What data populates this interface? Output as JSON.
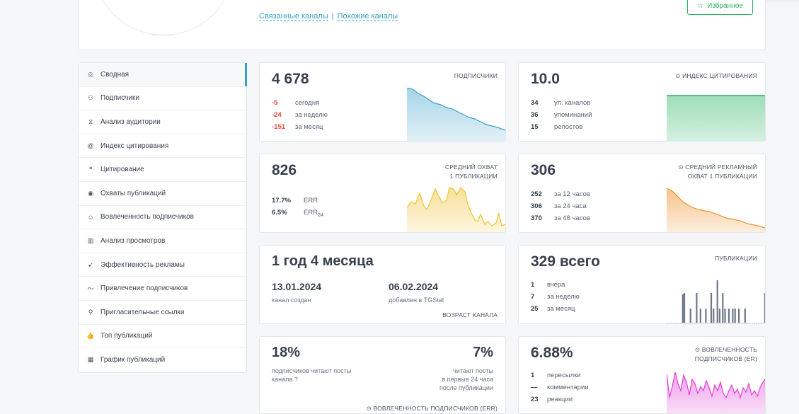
{
  "header": {
    "links": [
      "Связанные каналы",
      "Похожие каналы"
    ],
    "link_separator": "|",
    "favorite_label": "Избранное"
  },
  "sidebar": {
    "items": [
      {
        "label": "Сводная",
        "icon": "dashboard-icon",
        "active": true
      },
      {
        "label": "Подписчики",
        "icon": "users-icon"
      },
      {
        "label": "Анализ аудитории",
        "icon": "hourglass-icon"
      },
      {
        "label": "Индекс цитирования",
        "icon": "at-icon"
      },
      {
        "label": "Цитирование",
        "icon": "quote-icon"
      },
      {
        "label": "Охваты публикаций",
        "icon": "eye-icon"
      },
      {
        "label": "Вовлеченность подписчиков",
        "icon": "engagement-icon"
      },
      {
        "label": "Анализ просмотров",
        "icon": "bar-chart-icon"
      },
      {
        "label": "Эффективность рекламы",
        "icon": "rocket-icon"
      },
      {
        "label": "Привлечение подписчиков",
        "icon": "trend-icon"
      },
      {
        "label": "Пригласительные ссылки",
        "icon": "link-icon"
      },
      {
        "label": "Топ публикаций",
        "icon": "thumbs-up-icon"
      },
      {
        "label": "График публикаций",
        "icon": "calendar-icon"
      }
    ]
  },
  "subscribers": {
    "value": "4 678",
    "label": "ПОДПИСЧИКИ",
    "rows": [
      {
        "n": "-5",
        "t": "сегодня"
      },
      {
        "n": "-24",
        "t": "за неделю"
      },
      {
        "n": "-151",
        "t": "за месяц"
      }
    ],
    "color": "#3aa0c8"
  },
  "citation": {
    "value": "10.0",
    "label": "ИНДЕКС ЦИТИРОВАНИЯ",
    "rows": [
      {
        "n": "34",
        "t": "уп. каналов"
      },
      {
        "n": "36",
        "t": "упоминаний"
      },
      {
        "n": "15",
        "t": "репостов"
      }
    ],
    "color": "#28b463"
  },
  "reach": {
    "value": "826",
    "label_line1": "СРЕДНИЙ ОХВАТ",
    "label_line2": "1 ПУБЛИКАЦИИ",
    "rows": [
      {
        "n": "17.7%",
        "t": "ERR"
      },
      {
        "n": "6.5%",
        "t": "ERR",
        "sub": "24"
      }
    ],
    "color": "#f1c232"
  },
  "ad_reach": {
    "value": "306",
    "label_line1": "СРЕДНИЙ РЕКЛАМНЫЙ",
    "label_line2": "ОХВАТ 1 ПУБЛИКАЦИИ",
    "rows": [
      {
        "n": "252",
        "t": "за 12 часов"
      },
      {
        "n": "306",
        "t": "за 24 часа"
      },
      {
        "n": "370",
        "t": "за 48 часов"
      }
    ],
    "color": "#f0922b"
  },
  "age": {
    "value": "1 год 4 месяца",
    "created_date": "13.01.2024",
    "created_label": "канал создан",
    "added_date": "06.02.2024",
    "added_label": "добавлен в TGStat",
    "label": "ВОЗРАСТ КАНАЛА"
  },
  "posts": {
    "value": "329 всего",
    "label": "ПУБЛИКАЦИИ",
    "rows": [
      {
        "n": "1",
        "t": "вчера"
      },
      {
        "n": "7",
        "t": "за неделю"
      },
      {
        "n": "25",
        "t": "за месяц"
      }
    ],
    "color": "#6b7888"
  },
  "err": {
    "value_left": "18%",
    "desc_left_line1": "подписчиков читают посты",
    "desc_left_line2": "канала",
    "value_right": "7%",
    "desc_right_line1": "читают посты",
    "desc_right_line2": "в первые 24 часа",
    "desc_right_line3": "после публикации",
    "label": "ВОВЛЕЧЕННОСТЬ ПОДПИСЧИКОВ (ERR)"
  },
  "er": {
    "value": "6.88%",
    "label_line1": "ВОВЛЕЧЕННОСТЬ",
    "label_line2": "ПОДПИСЧИКОВ (ER)",
    "rows": [
      {
        "n": "1",
        "t": "пересылки"
      },
      {
        "n": "—",
        "t": "комментарии"
      },
      {
        "n": "23",
        "t": "реакции"
      }
    ],
    "color": "#e040d8"
  }
}
